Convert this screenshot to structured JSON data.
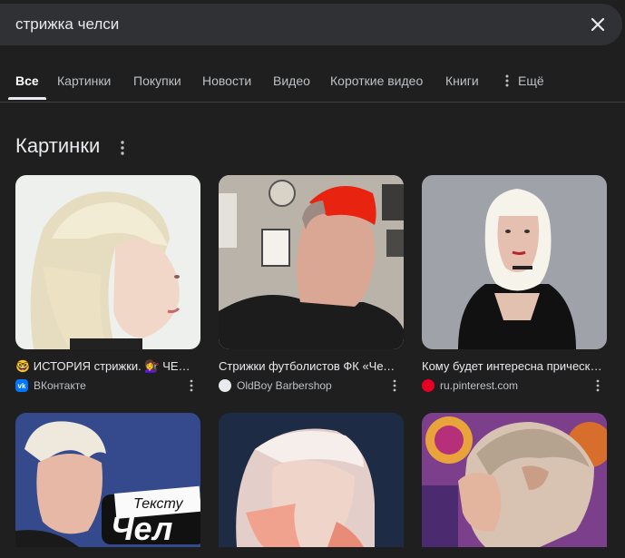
{
  "search": {
    "query": "стрижка челси"
  },
  "tabs": [
    {
      "label": "Все"
    },
    {
      "label": "Картинки"
    },
    {
      "label": "Покупки"
    },
    {
      "label": "Новости"
    },
    {
      "label": "Видео"
    },
    {
      "label": "Короткие видео"
    },
    {
      "label": "Книги"
    },
    {
      "label": "Ещё"
    }
  ],
  "images_section": {
    "title": "Картинки"
  },
  "results": [
    {
      "caption": "🤓 ИСТОРИЯ стрижки. 💇‍♀️ ЧЕЛСИ",
      "source": "ВКонтакте",
      "source_icon": "vk-icon"
    },
    {
      "caption": "Стрижки футболистов ФК «Челси»",
      "source": "OldBoy Barbershop",
      "source_icon": "oldboy-icon"
    },
    {
      "caption": "Кому будет интересна прическа челси",
      "source": "ru.pinterest.com",
      "source_icon": "pinterest-icon"
    }
  ],
  "overlay_text": {
    "line1": "Тексту",
    "line2": "Чел"
  },
  "colors": {
    "background": "#1f1f1f",
    "searchbar": "#303134",
    "vk": "#0077ff",
    "pinterest": "#e60023"
  }
}
